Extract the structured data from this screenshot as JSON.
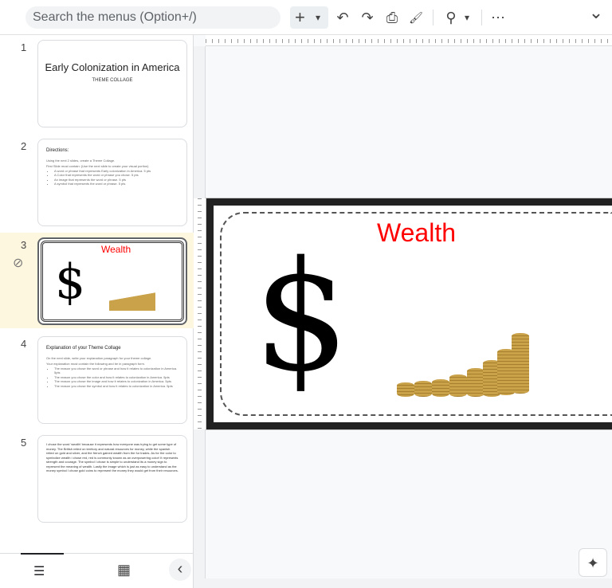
{
  "toolbar": {
    "search_placeholder": "Search the menus (Option+/)",
    "add": "+",
    "add_caret": "▾",
    "undo": "↶",
    "redo": "↷",
    "print": "⎙",
    "paint_format": "🖌",
    "zoom": "⚲",
    "zoom_caret": "▾",
    "more": "⋯",
    "collapse": "⌄"
  },
  "slides": [
    {
      "number": "1",
      "title": "Early Colonization in America",
      "subtitle": "THEME COLLAGE"
    },
    {
      "number": "2",
      "title": "Directions:",
      "lines": [
        "Using the next 2 slides, create a Theme Collage.",
        "First Slide must contain: (Use the next slide to create your visual portion)"
      ],
      "bullets": [
        "A word or phrase that represents Early colonization in America. 5 pts",
        "A Color that represents the word or phrase you chose. 5 pts",
        "An image that represents the word or phrase. 5 pts",
        "A symbol that represents the word or phrase. 5 pts"
      ]
    },
    {
      "number": "3",
      "title": "Wealth",
      "symbol": "$"
    },
    {
      "number": "4",
      "title": "Explanation of your Theme Collage",
      "lines": [
        "On the next slide, write your explanation paragraph for your theme collage.",
        "Your explanation must contain the following and be in paragraph form."
      ],
      "bullets": [
        "The reason you chose the word or phrase and how it relates to colonization in America. 5pts",
        "The reason you chose the color and how it relates to colonization in America. 5pts",
        "The reason you chose the image and how it relates to colonization in America. 5pts",
        "The reason you chose the symbol and how it relates to colonization in America. 5pts"
      ]
    },
    {
      "number": "5",
      "body": "I chose the word 'wealth' because it represents how everyone was trying to get some type of money. The British relied on territory and natural resources for money, while the spanish relied on gold and silver, and the french gained wealth from the fur trades. As for the color to symbolize wealth i chose red, red is commonly known as an overpowering color! It represents strength and courage. The symbol I chose is simple to understand its a money sign to represent the meaning of wealth. Lastly the image which is just as easy to understand as the money symbol I chose gold coins to represent the money they would get from their resources."
    }
  ],
  "main_slide": {
    "title": "Wealth",
    "symbol": "$",
    "title_color": "#ff0000"
  },
  "bottom": {
    "filmstrip_view": "☰",
    "grid_view": "▦",
    "collapse": "‹"
  },
  "assist": "✦"
}
